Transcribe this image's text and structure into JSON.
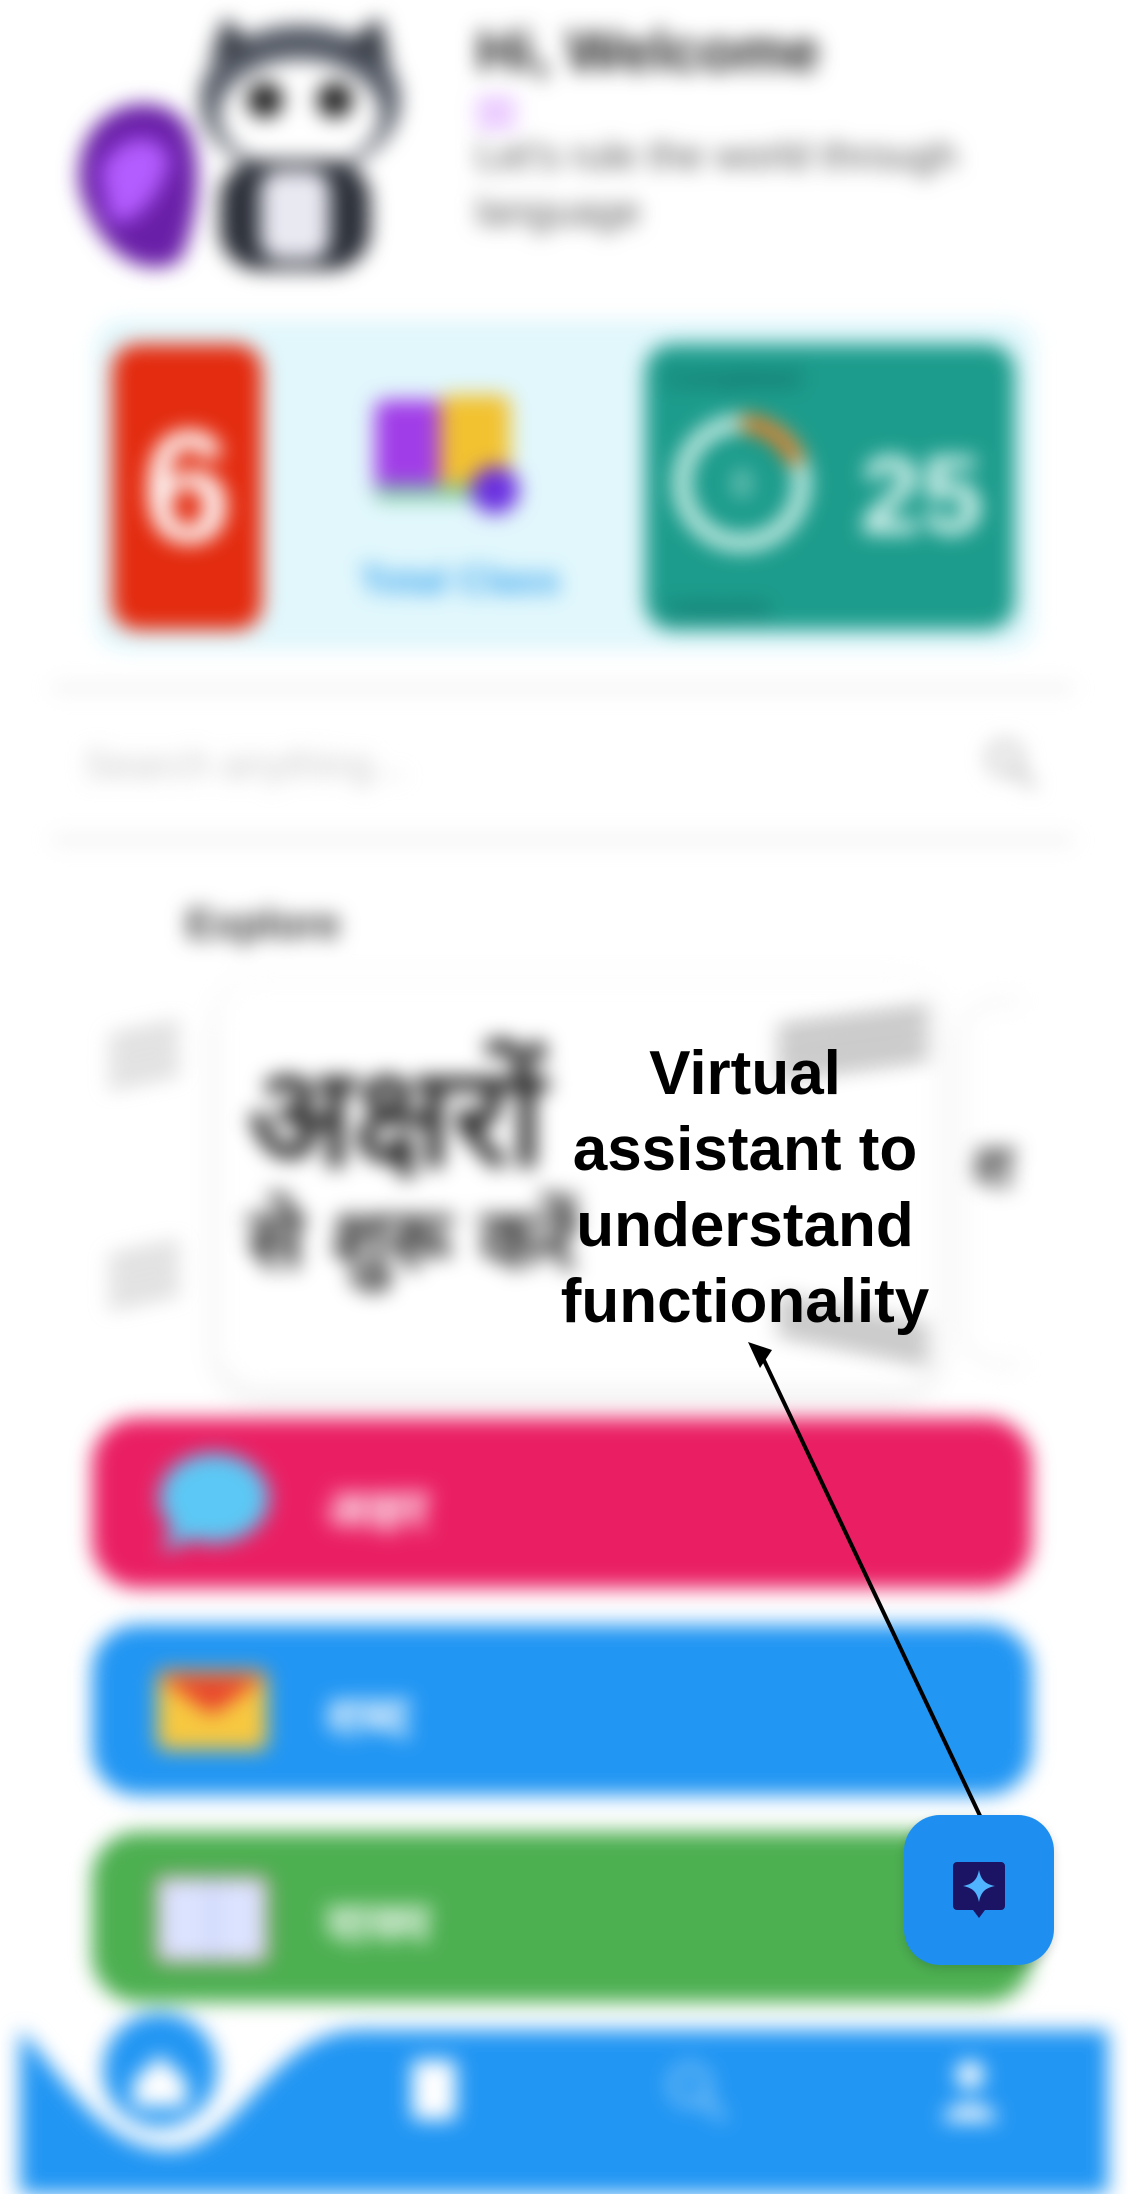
{
  "header": {
    "title": "Hi, Welcome",
    "subtitle": "Let's rule the world through language"
  },
  "stats": {
    "streak_value": "6",
    "total_class_label": "Total Class",
    "progress_top_label": "Completed",
    "progress_bottom_label": "Lessons",
    "progress_ring_value": "8",
    "progress_number": "25"
  },
  "search": {
    "placeholder": "Search anything..."
  },
  "explore": {
    "title": "Explore",
    "card_line1": "अक्षरों",
    "card_line2": "से शुरू करें",
    "side_card_text": "श"
  },
  "categories": [
    {
      "label": "अक्षर",
      "color": "#ea1f63",
      "icon": "speech-bubble-icon"
    },
    {
      "label": "शब्द",
      "color": "#2196f3",
      "icon": "envelope-icon"
    },
    {
      "label": "वाक्य",
      "color": "#4caf50",
      "icon": "book-icon"
    }
  ],
  "bottom_nav": {
    "items": [
      "home-icon",
      "book-icon",
      "search-icon",
      "profile-icon"
    ],
    "color": "#2196f3"
  },
  "annotation": {
    "text": "Virtual assistant to understand functionality"
  },
  "assistant_button": {
    "icon": "sparkle-chat-icon",
    "color": "#1e8ff0"
  }
}
